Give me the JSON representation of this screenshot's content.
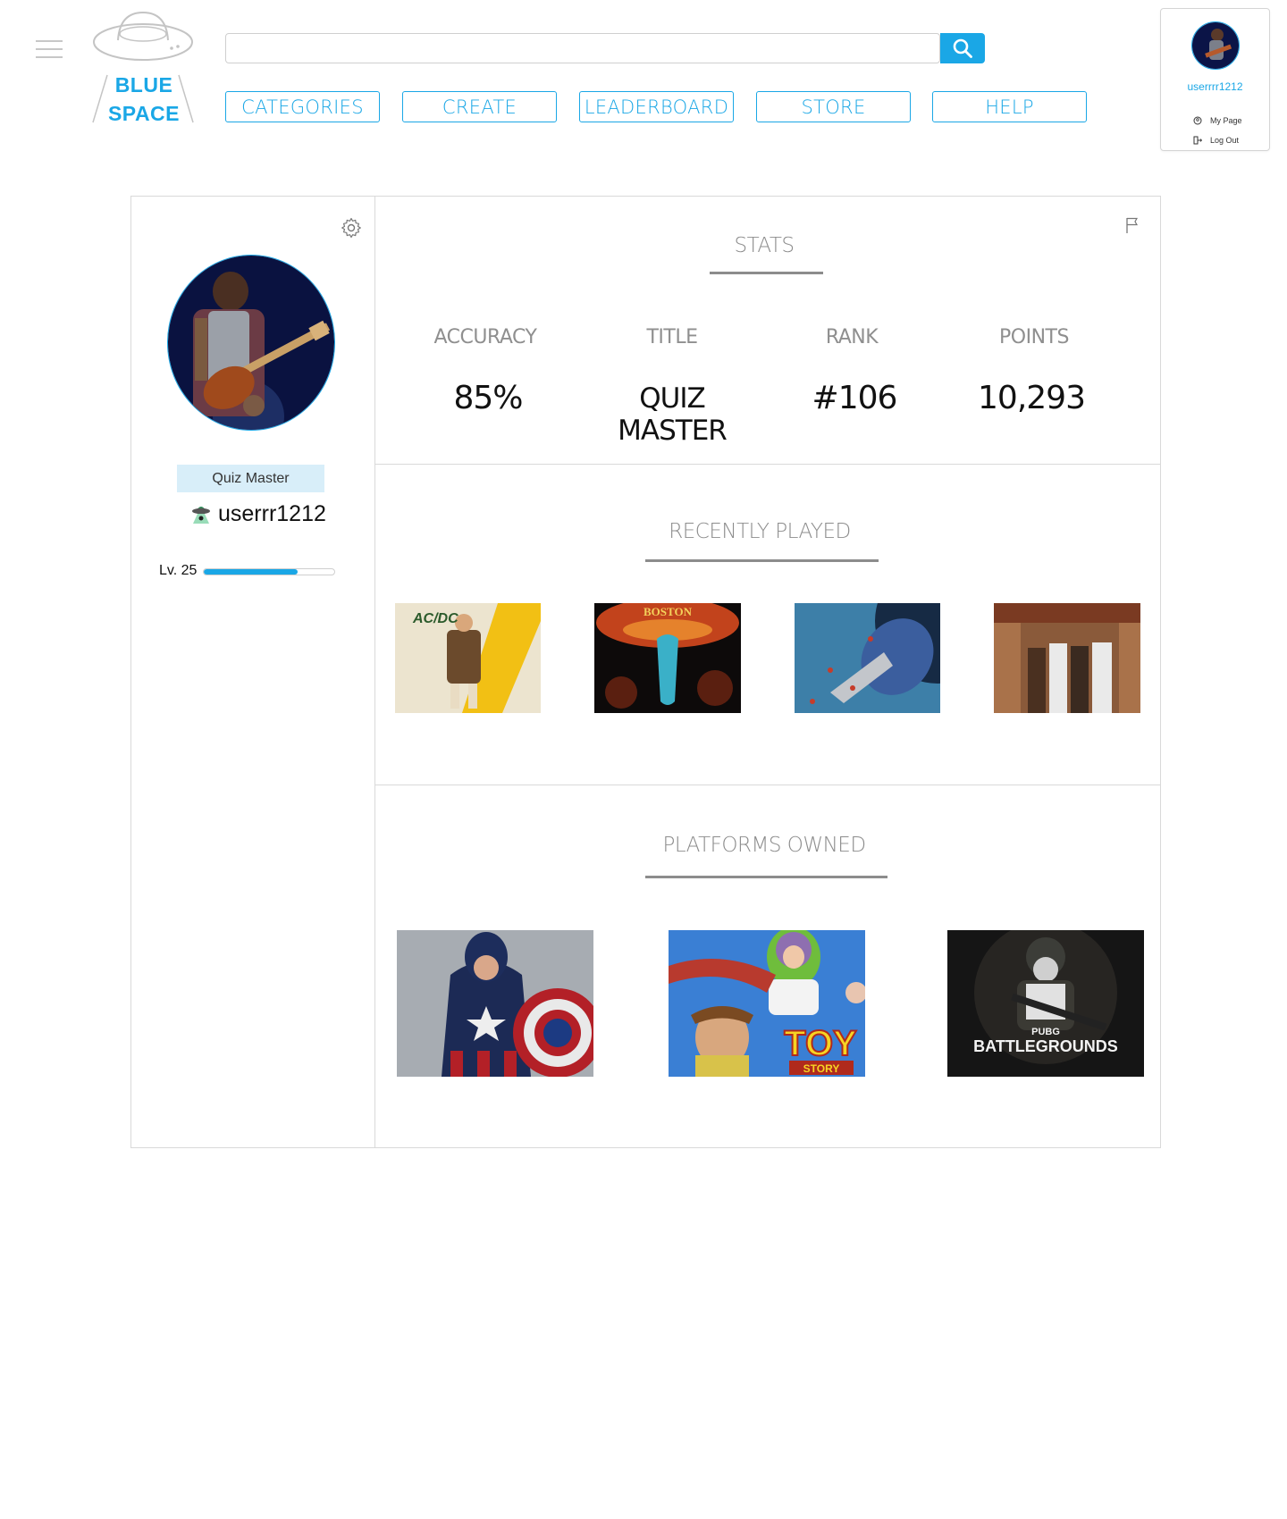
{
  "brand": {
    "line1": "BLUE",
    "line2": "SPACE",
    "accent_color": "#1aa7e6"
  },
  "search": {
    "value": "",
    "placeholder": "",
    "button_icon": "search-icon"
  },
  "nav": [
    {
      "label": "CATEGORIES"
    },
    {
      "label": "CREATE"
    },
    {
      "label": "LEADERBOARD"
    },
    {
      "label": "STORE"
    },
    {
      "label": "HELP"
    }
  ],
  "user_menu": {
    "username": "userrrr1212",
    "my_page": "My Page",
    "log_out": "Log Out"
  },
  "profile": {
    "title_badge": "Quiz Master",
    "username": "userrr1212",
    "level_label": "Lv. 25",
    "level_progress": 0.72
  },
  "stats": {
    "heading": "STATS",
    "items": [
      {
        "label": "ACCURACY",
        "value": "85%"
      },
      {
        "label": "TITLE",
        "value": "QUIZ MASTER"
      },
      {
        "label": "RANK",
        "value": "#106"
      },
      {
        "label": "POINTS",
        "value": "10,293"
      }
    ]
  },
  "recently_played": {
    "heading": "RECENTLY PLAYED",
    "items": [
      {
        "text": "AC/DC"
      },
      {
        "text": "BOSTON"
      },
      {
        "text": ""
      },
      {
        "text": ""
      }
    ]
  },
  "platforms_owned": {
    "heading": "PLATFORMS OWNED",
    "items": [
      {
        "text": ""
      },
      {
        "text": "TOY",
        "subtext": "STORY"
      },
      {
        "text": "PUBG",
        "subtext": "BATTLEGROUNDS"
      }
    ]
  }
}
